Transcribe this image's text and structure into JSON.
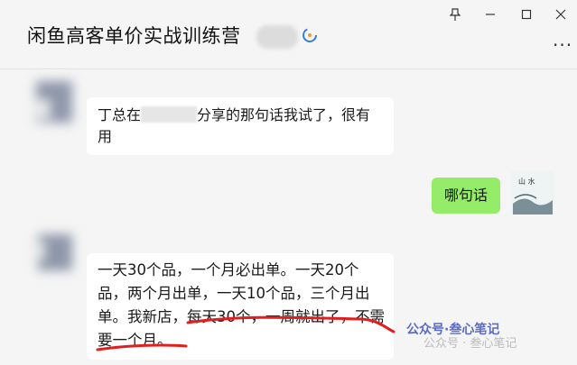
{
  "header": {
    "title": "闲鱼高客单价实战训练营"
  },
  "window_controls": [
    "pin-icon",
    "minimize-icon",
    "maximize-icon",
    "close-icon"
  ],
  "more_label": "···",
  "messages": {
    "m1_text_a": "丁总在",
    "m1_text_b": "分享的那句话我试了，很有用",
    "m2_text": "哪句话",
    "m3_text": "一天30个品，一个月必出单。一天20个品，两个月出单，一天10个品，三个月出单。我新店，每天30个，一周就出了，不需要一个月。"
  },
  "watermarks": {
    "brand": "公众号·叁心笔记",
    "footer": "公众号 · 叁心笔记"
  },
  "colors": {
    "underline": "#e02020",
    "self_bubble": "#95ec69"
  }
}
